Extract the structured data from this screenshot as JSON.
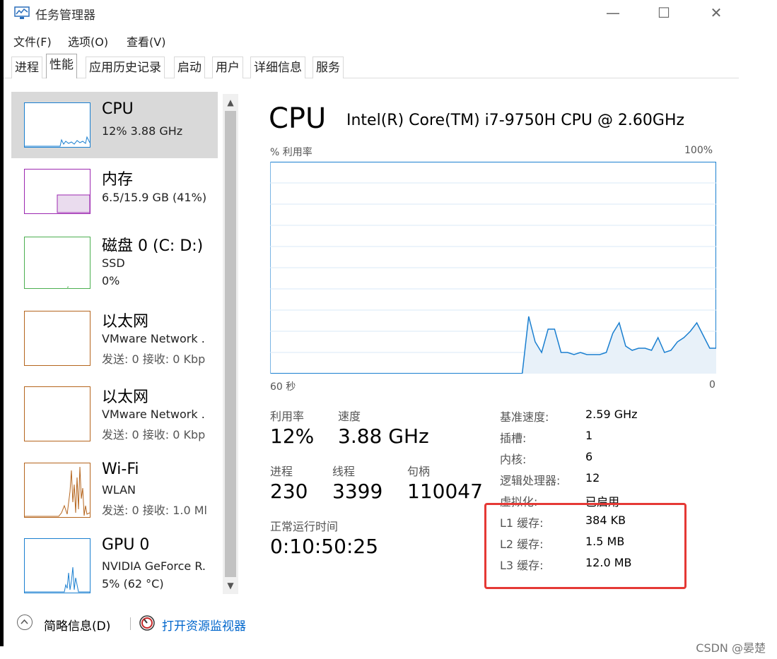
{
  "window": {
    "title": "任务管理器",
    "minimize": "—",
    "maximize": "☐",
    "close": "✕"
  },
  "menu": [
    "文件(F)",
    "选项(O)",
    "查看(V)"
  ],
  "tabs": [
    "进程",
    "性能",
    "应用历史记录",
    "启动",
    "用户",
    "详细信息",
    "服务"
  ],
  "sidebar": [
    {
      "title": "CPU",
      "sub": "12% 3.88 GHz",
      "sub2": "",
      "color": "#1a7fd0"
    },
    {
      "title": "内存",
      "sub": "6.5/15.9 GB (41%)",
      "sub2": "",
      "color": "#9c27b0"
    },
    {
      "title": "磁盘 0 (C: D:)",
      "sub": "SSD",
      "sub2": "0%",
      "color": "#4caf50"
    },
    {
      "title": "以太网",
      "sub": "VMware Network .",
      "sub2": "发送: 0 接收: 0 Kbp",
      "color": "#b5651d"
    },
    {
      "title": "以太网",
      "sub": "VMware Network .",
      "sub2": "发送: 0 接收: 0 Kbp",
      "color": "#b5651d"
    },
    {
      "title": "Wi-Fi",
      "sub": "WLAN",
      "sub2": "发送: 0 接收: 1.0 Ml",
      "color": "#b5651d"
    },
    {
      "title": "GPU 0",
      "sub": "NVIDIA GeForce R.",
      "sub2": "5% (62 °C)",
      "color": "#1a7fd0"
    }
  ],
  "main": {
    "title": "CPU",
    "cpu_name": "Intel(R) Core(TM) i7-9750H CPU @ 2.60GHz",
    "util_label": "% 利用率",
    "max_label": "100%",
    "time_label": "60 秒",
    "zero_label": "0",
    "utilization_label": "利用率",
    "utilization": "12%",
    "speed_label": "速度",
    "speed": "3.88 GHz",
    "processes_label": "进程",
    "processes": "230",
    "threads_label": "线程",
    "threads": "3399",
    "handles_label": "句柄",
    "handles": "110047",
    "uptime_label": "正常运行时间",
    "uptime": "0:10:50:25",
    "specs": [
      {
        "label": "基准速度:",
        "value": "2.59 GHz"
      },
      {
        "label": "插槽:",
        "value": "1"
      },
      {
        "label": "内核:",
        "value": "6"
      },
      {
        "label": "逻辑处理器:",
        "value": "12"
      },
      {
        "label": "虚拟化:",
        "value": "已启用"
      },
      {
        "label": "L1 缓存:",
        "value": "384 KB"
      },
      {
        "label": "L2 缓存:",
        "value": "1.5 MB"
      },
      {
        "label": "L3 缓存:",
        "value": "12.0 MB"
      }
    ],
    "graph_history": [
      0,
      0,
      0,
      0,
      0,
      0,
      0,
      0,
      0,
      0,
      0,
      0,
      0,
      0,
      0,
      0,
      0,
      0,
      0,
      0,
      0,
      0,
      0,
      0,
      0,
      0,
      0,
      0,
      0,
      0,
      0,
      0,
      0,
      0,
      0,
      0,
      0,
      0,
      0,
      0,
      27,
      15,
      10,
      21,
      21,
      10,
      10,
      9,
      10,
      9,
      9,
      9,
      10,
      19,
      24,
      13,
      11,
      12,
      12,
      11,
      17,
      10,
      11,
      15,
      17,
      20,
      24,
      18,
      12,
      12
    ],
    "accent": "#1a7fd0"
  },
  "footer": {
    "summary": "简略信息(D)",
    "monitor": "打开资源监视器"
  },
  "watermark": "CSDN @晏楚"
}
